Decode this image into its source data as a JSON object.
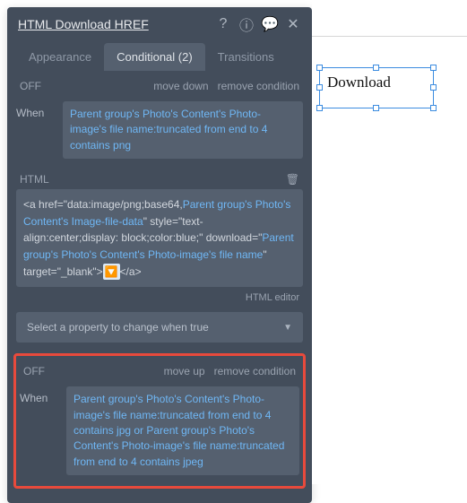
{
  "panel": {
    "title": "HTML Download HREF",
    "tabs": {
      "appearance": "Appearance",
      "conditional": "Conditional (2)",
      "transitions": "Transitions"
    },
    "cond1": {
      "state": "OFF",
      "move": "move down",
      "remove": "remove condition",
      "whenLabel": "When",
      "whenExpr": "Parent group's Photo's Content's Photo-image's file name:truncated from end to 4 contains png",
      "htmlLabel": "HTML",
      "html_p1_before": "<a href=\"data:image/png;base64,",
      "html_p1_expr": "Parent group's Photo's Content's Image-file-data",
      "html_p2_before": "\" style=\"text-align:center;display: block;color:blue;\" download=\"",
      "html_p2_expr": "Parent group's Photo's Content's Photo-image's file name",
      "html_p3_before": "\" target=\"_blank\">",
      "html_p3_after": "</a>",
      "editor_link": "HTML editor",
      "select_placeholder": "Select a property to change when true"
    },
    "cond2": {
      "state": "OFF",
      "move": "move up",
      "remove": "remove condition",
      "whenLabel": "When",
      "whenExpr": "Parent group's Photo's Content's Photo-image's file name:truncated from end to 4 contains jpg or Parent group's Photo's Content's Photo-image's file name:truncated from end to 4 contains jpeg"
    }
  },
  "canvas": {
    "download_label": "Download"
  }
}
